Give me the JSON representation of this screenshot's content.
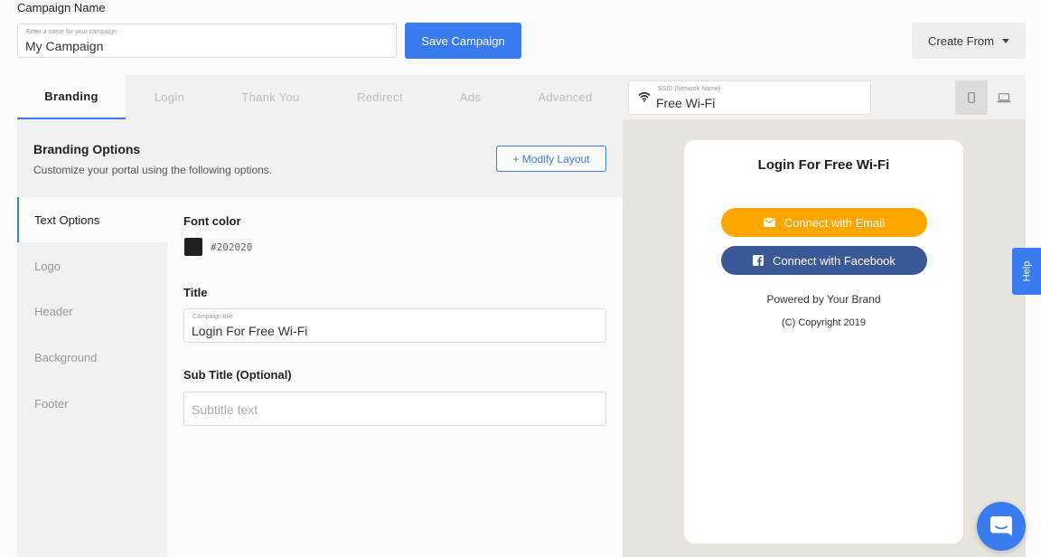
{
  "header": {
    "campaign_label": "Campaign Name",
    "name_hint": "Enter a name for your campaign",
    "name_value": "My Campaign",
    "save_label": "Save Campaign",
    "create_from_label": "Create From"
  },
  "tabs": [
    {
      "label": "Branding"
    },
    {
      "label": "Login"
    },
    {
      "label": "Thank You"
    },
    {
      "label": "Redirect"
    },
    {
      "label": "Ads"
    },
    {
      "label": "Advanced"
    }
  ],
  "ssid": {
    "hint": "SSID (Network Name)",
    "value": "Free Wi-Fi"
  },
  "options": {
    "title": "Branding Options",
    "subtitle": "Customize your portal using the following options.",
    "modify_label": "+ Modify Layout"
  },
  "side_nav": [
    {
      "label": "Text Options"
    },
    {
      "label": "Logo"
    },
    {
      "label": "Header"
    },
    {
      "label": "Background"
    },
    {
      "label": "Footer"
    }
  ],
  "form": {
    "font_color_label": "Font color",
    "font_color_value": "#202020",
    "title_label": "Title",
    "title_hint": "Campaign title",
    "title_value": "Login For Free Wi-Fi",
    "subtitle_label": "Sub Title (Optional)",
    "subtitle_placeholder": "Subtitle text"
  },
  "preview": {
    "title": "Login For Free Wi-Fi",
    "email_button": "Connect with Email",
    "facebook_button": "Connect with Facebook",
    "powered": "Powered by Your Brand",
    "copyright": "(C) Copyright 2019"
  },
  "help_label": "Help",
  "colors": {
    "accent": "#3b7bf0",
    "email": "#ffa600",
    "facebook": "#3b5998",
    "font": "#202020"
  }
}
